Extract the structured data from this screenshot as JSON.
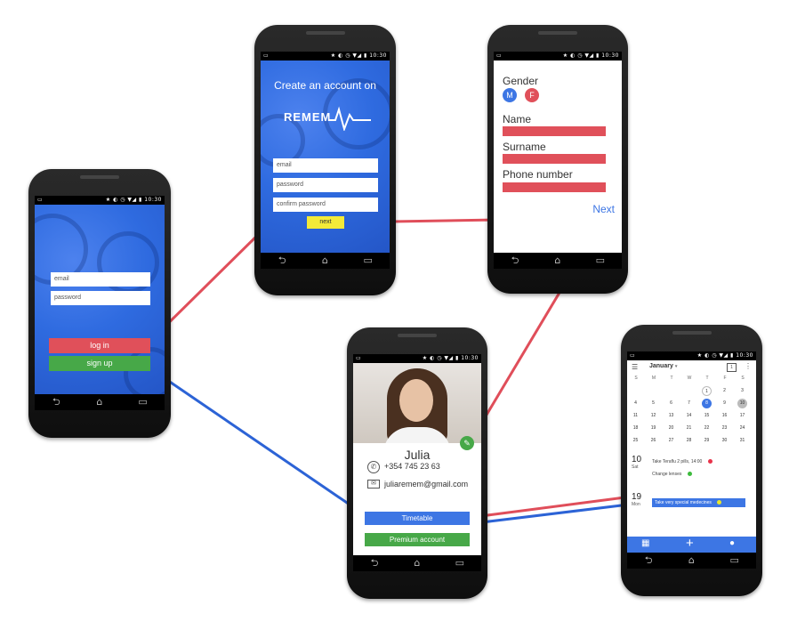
{
  "login": {
    "email_placeholder": "email",
    "password_placeholder": "password",
    "login_label": "log in",
    "signup_label": "sign up"
  },
  "create": {
    "title": "Create an account on",
    "logo_text": "REMEM",
    "email_placeholder": "email",
    "password_placeholder": "password",
    "confirm_placeholder": "confirm password",
    "next_label": "next"
  },
  "details": {
    "gender_label": "Gender",
    "gender_m": "M",
    "gender_f": "F",
    "name_label": "Name",
    "surname_label": "Surname",
    "phone_label": "Phone number",
    "next_label": "Next"
  },
  "profile": {
    "name": "Julia",
    "phone": "+354 745 23 63",
    "email": "juliaremem@gmail.com",
    "timetable_label": "Timetable",
    "premium_label": "Premium account"
  },
  "calendar": {
    "month": "January",
    "weekdays": [
      "S",
      "M",
      "T",
      "W",
      "T",
      "F",
      "S"
    ],
    "rows": [
      [
        "",
        "",
        "",
        "",
        "1",
        "2",
        "3"
      ],
      [
        "4",
        "5",
        "6",
        "7",
        "8",
        "9",
        "10"
      ],
      [
        "11",
        "12",
        "13",
        "14",
        "15",
        "16",
        "17"
      ],
      [
        "18",
        "19",
        "20",
        "21",
        "22",
        "23",
        "24"
      ],
      [
        "25",
        "26",
        "27",
        "28",
        "29",
        "30",
        "31"
      ]
    ],
    "selected_day": "8",
    "marked_day": "10",
    "events": [
      {
        "day": "10",
        "dow": "Sat",
        "items": [
          {
            "text": "Take Teraflu 2 pills, 14:00",
            "color": "#e8334a"
          },
          {
            "text": "Change lenses",
            "color": "#3dbb3d"
          }
        ]
      },
      {
        "day": "19",
        "dow": "Mon",
        "items": [
          {
            "text": "Take very special medecines",
            "color": "#e8e62c"
          }
        ]
      }
    ]
  },
  "colors": {
    "blue": "#3d76e4",
    "red": "#e0505a",
    "green": "#47a848",
    "yellow": "#f3ea38",
    "link_red": "#e04e5a",
    "link_blue": "#2c63d6"
  }
}
